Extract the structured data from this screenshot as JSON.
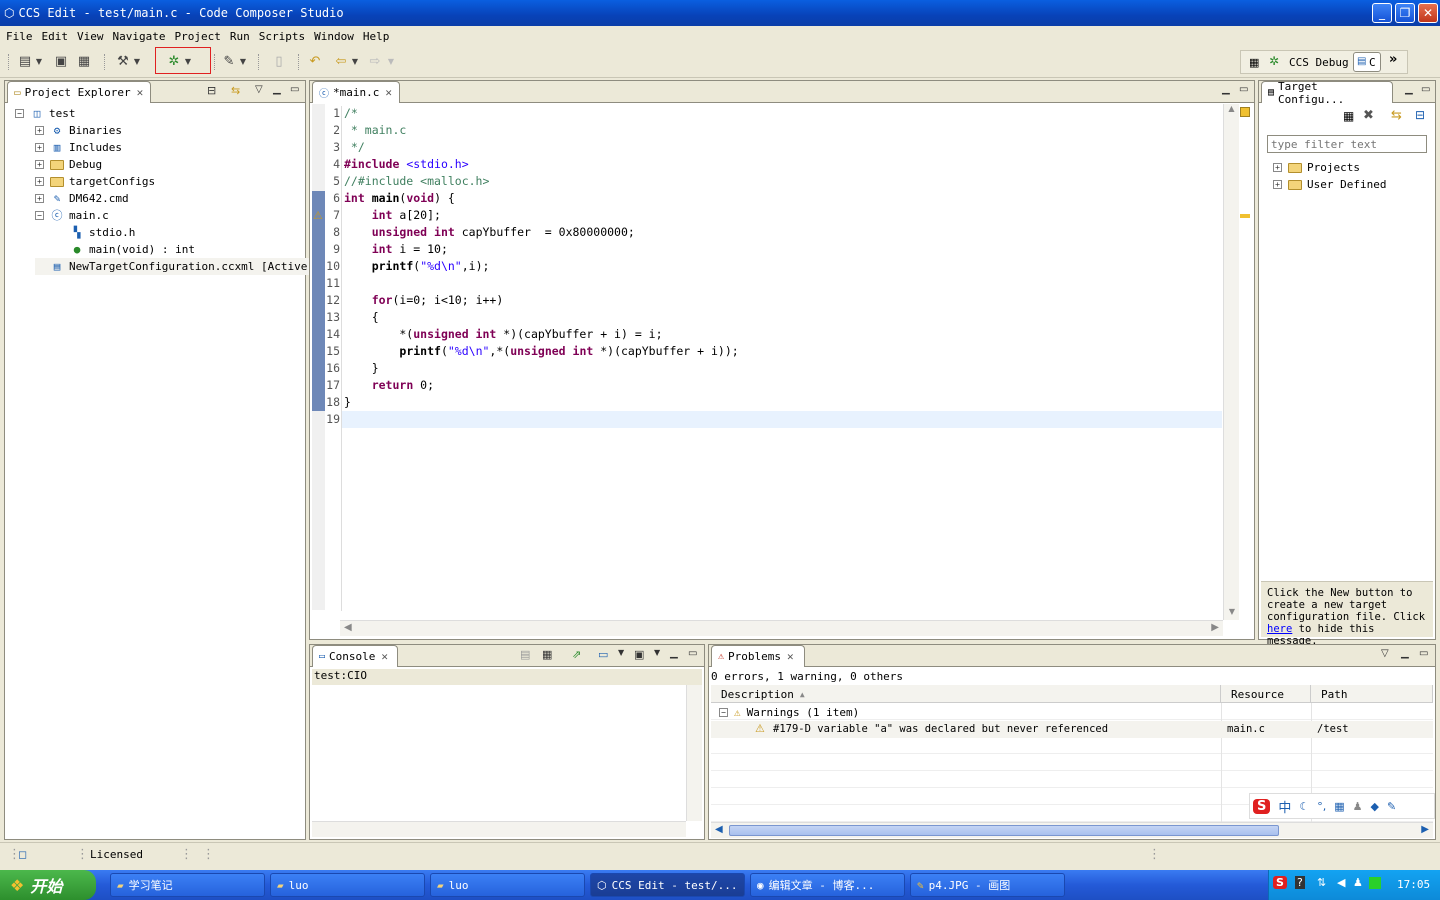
{
  "window": {
    "title": "CCS Edit - test/main.c - Code Composer Studio",
    "min": "_",
    "max": "❐",
    "close": "✕"
  },
  "menu": [
    "File",
    "Edit",
    "View",
    "Navigate",
    "Project",
    "Run",
    "Scripts",
    "Window",
    "Help"
  ],
  "perspectives": {
    "debug": "CCS Debug",
    "edit": "C",
    "more": "»"
  },
  "project_explorer": {
    "tab": "Project Explorer",
    "items": [
      {
        "label": "test",
        "level": 0,
        "exp": "⊟",
        "icon": "project-icon"
      },
      {
        "label": "Binaries",
        "level": 1,
        "exp": "⊞",
        "icon": "binaries-icon"
      },
      {
        "label": "Includes",
        "level": 1,
        "exp": "⊞",
        "icon": "includes-icon"
      },
      {
        "label": "Debug",
        "level": 1,
        "exp": "⊞",
        "icon": "folder-icon"
      },
      {
        "label": "targetConfigs",
        "level": 1,
        "exp": "⊞",
        "icon": "folder-icon"
      },
      {
        "label": "DM642.cmd",
        "level": 1,
        "exp": "⊞",
        "icon": "cmd-file-icon"
      },
      {
        "label": "main.c",
        "level": 1,
        "exp": "⊟",
        "icon": "c-file-icon"
      },
      {
        "label": "stdio.h",
        "level": 2,
        "exp": "",
        "icon": "header-icon"
      },
      {
        "label": "main(void) : int",
        "level": 2,
        "exp": "",
        "icon": "function-icon"
      },
      {
        "label": "NewTargetConfiguration.ccxml [Active]",
        "level": 1,
        "exp": "",
        "icon": "ccxml-file-icon"
      }
    ]
  },
  "editor": {
    "tab": "*main.c",
    "lines": [
      {
        "n": "1",
        "html": "<span class='cm'>/*</span>"
      },
      {
        "n": "2",
        "html": "<span class='cm'> * main.c</span>"
      },
      {
        "n": "3",
        "html": "<span class='cm'> */</span>"
      },
      {
        "n": "4",
        "html": "<span class='pp'>#include</span> <span class='st'>&lt;stdio.h&gt;</span>"
      },
      {
        "n": "5",
        "html": "<span class='cm'>//#include &lt;malloc.h&gt;</span>"
      },
      {
        "n": "6",
        "html": "<span class='kw'>int</span> <b>main</b>(<span class='kw'>void</span>) {"
      },
      {
        "n": "7",
        "html": "    <span class='kw'>int</span> a[20];"
      },
      {
        "n": "8",
        "html": "    <span class='kw'>unsigned int</span> capYbuffer  = 0x80000000;"
      },
      {
        "n": "9",
        "html": "    <span class='kw'>int</span> i = 10;"
      },
      {
        "n": "10",
        "html": "    <b>printf</b>(<span class='st'>\"%d\\n\"</span>,i);"
      },
      {
        "n": "11",
        "html": ""
      },
      {
        "n": "12",
        "html": "    <span class='kw'>for</span>(i=0; i&lt;10; i++)"
      },
      {
        "n": "13",
        "html": "    {"
      },
      {
        "n": "14",
        "html": "        *(<span class='kw'>unsigned int</span> *)(capYbuffer + i) = i;"
      },
      {
        "n": "15",
        "html": "        <b>printf</b>(<span class='st'>\"%d\\n\"</span>,*(<span class='kw'>unsigned int</span> *)(capYbuffer + i));"
      },
      {
        "n": "16",
        "html": "    }"
      },
      {
        "n": "17",
        "html": "    <span class='kw'>return</span> 0;"
      },
      {
        "n": "18",
        "html": "}"
      },
      {
        "n": "19",
        "html": ""
      }
    ]
  },
  "target_config": {
    "tab": "Target Configu...",
    "filter_placeholder": "type filter text",
    "items": [
      "Projects",
      "User Defined"
    ],
    "message_pre": "Click the New button to create a new target configuration file. Click ",
    "message_link": "here",
    "message_post": " to hide this message."
  },
  "console": {
    "tab": "Console",
    "label": "test:CIO"
  },
  "problems": {
    "tab": "Problems",
    "summary": "0 errors, 1 warning, 0 others",
    "columns": [
      "Description",
      "Resource",
      "Path"
    ],
    "group": "Warnings (1 item)",
    "rows": [
      {
        "description": "#179-D variable \"a\" was declared but never referenced",
        "resource": "main.c",
        "path": "/test"
      }
    ]
  },
  "status": {
    "licensed": "Licensed"
  },
  "taskbar": {
    "start": "开始",
    "tasks": [
      "学习笔记",
      "luo",
      "luo",
      "CCS Edit - test/...",
      "编辑文章 - 博客...",
      "p4.JPG - 画图"
    ],
    "clock": "17:05",
    "ime": "中"
  }
}
